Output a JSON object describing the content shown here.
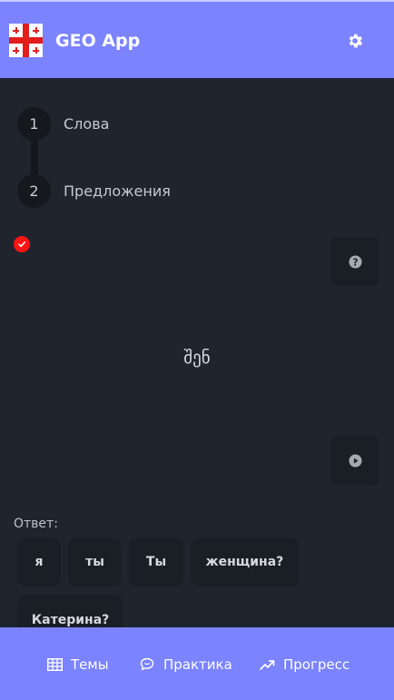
{
  "header": {
    "app_title": "GEO App",
    "flag_icon": "georgia-flag-icon",
    "settings_icon": "gear-icon"
  },
  "stepper": {
    "steps": [
      {
        "number": "1",
        "label": "Слова"
      },
      {
        "number": "2",
        "label": "Предложения"
      }
    ]
  },
  "card": {
    "status_icon": "check-circle-icon",
    "status_color": "#ff1414",
    "help_icon": "question-icon",
    "play_icon": "play-icon",
    "word": "შენ"
  },
  "answer": {
    "label": "Ответ:",
    "options": [
      "я",
      "ты",
      "Ты",
      "женщина?",
      "Катерина?"
    ]
  },
  "bottom_nav": {
    "items": [
      {
        "label": "Темы",
        "icon": "table-icon"
      },
      {
        "label": "Практика",
        "icon": "chat-icon"
      },
      {
        "label": "Прогресс",
        "icon": "trend-up-icon"
      }
    ]
  },
  "colors": {
    "accent": "#7b83ff",
    "background": "#1f242d"
  }
}
